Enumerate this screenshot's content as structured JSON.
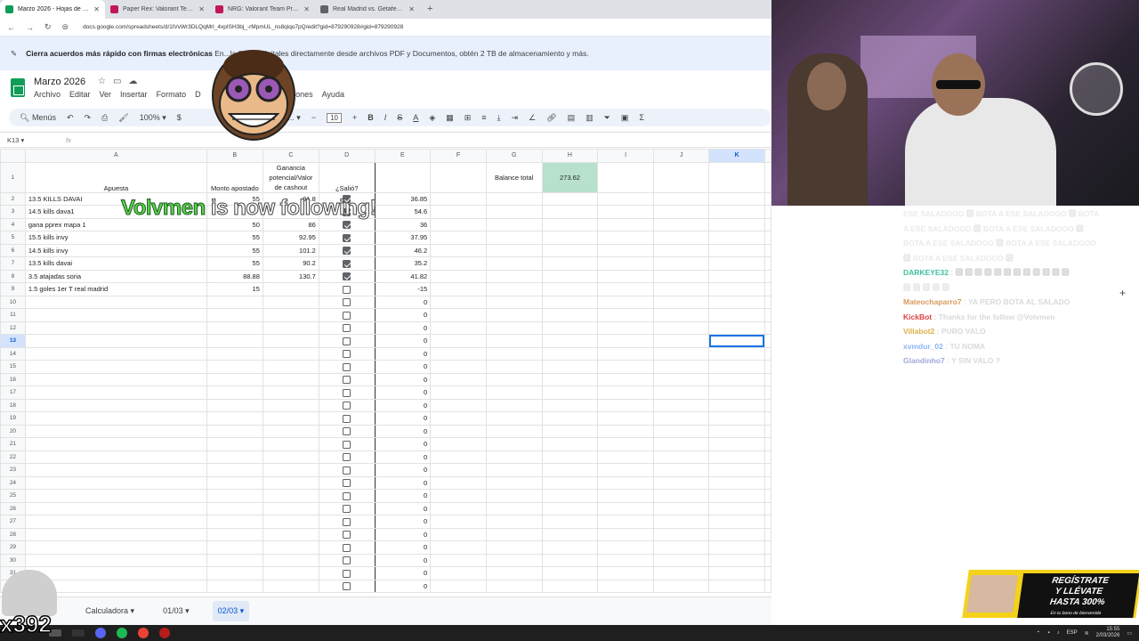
{
  "browser": {
    "tabs": [
      {
        "label": "Marzo 2026 - Hojas de cálculo",
        "color": "#0f9d58",
        "active": true
      },
      {
        "label": "Paper Rex: Valorant Team Profile",
        "color": "#c2185b",
        "active": false
      },
      {
        "label": "NRG: Valorant Team Profile | V...",
        "color": "#c2185b",
        "active": false
      },
      {
        "label": "Real Madrid vs. Getafe CF | Dis...",
        "color": "#5f6368",
        "active": false
      }
    ],
    "url": "docs.google.com/spreadsheets/d/1lVvWr3DLQqMrl_4xpISH3bj_-rMpmUL_ns8qiqo7pQ/edit?gid=879290928#gid=879290928"
  },
  "banner": {
    "bold": "Cierra acuerdos más rápido con firmas electrónicas",
    "text": "En...la firmas digitales directamente desde archivos PDF y Documentos, obtén 2 TB de almacenamiento y más."
  },
  "doc": {
    "title": "Marzo 2026",
    "menu": [
      "Archivo",
      "Editar",
      "Ver",
      "Insertar",
      "Formato",
      "D",
      "siones",
      "Ayuda"
    ]
  },
  "toolbar": {
    "menus_label": "Menús",
    "zoom": "100%",
    "currency": "$",
    "font": "edet...",
    "font_size": "10"
  },
  "formula": {
    "namebox": "K13",
    "fx": "fx"
  },
  "sheet": {
    "columns": [
      "A",
      "B",
      "C",
      "D",
      "E",
      "F",
      "G",
      "H",
      "I",
      "J",
      "K"
    ],
    "header": {
      "a": "Apuesta",
      "b": "Monto apostado",
      "c": "Ganancia potencial/Valor de cashout",
      "d": "¿Salió?",
      "g": "Balance total",
      "h": "273.62"
    },
    "rows": [
      {
        "n": "2",
        "a": "13.5 KILLS DAVAI",
        "b": "55",
        "c": "91.8",
        "checked": true,
        "e": "36.85"
      },
      {
        "n": "3",
        "a": "14.5 kills dava1",
        "b": "",
        "c": "",
        "checked": true,
        "e": "54.6"
      },
      {
        "n": "4",
        "a": "gana pprex mapa 1",
        "b": "50",
        "c": "86",
        "checked": true,
        "e": "36"
      },
      {
        "n": "5",
        "a": "15.5 kills invy",
        "b": "55",
        "c": "92.95",
        "checked": true,
        "e": "37.95"
      },
      {
        "n": "6",
        "a": "14.5 kills invy",
        "b": "55",
        "c": "101.2",
        "checked": true,
        "e": "46.2"
      },
      {
        "n": "7",
        "a": "13.5 kills davai",
        "b": "55",
        "c": "90.2",
        "checked": true,
        "e": "35.2"
      },
      {
        "n": "8",
        "a": "3.5 atajadas soria",
        "b": "88.88",
        "c": "130.7",
        "checked": true,
        "e": "41.82"
      },
      {
        "n": "9",
        "a": "1.5 goles 1er T real madrid",
        "b": "15",
        "c": "",
        "checked": false,
        "e": "-15"
      },
      {
        "n": "10",
        "a": "",
        "b": "",
        "c": "",
        "checked": false,
        "e": "0"
      },
      {
        "n": "11",
        "a": "",
        "b": "",
        "c": "",
        "checked": false,
        "e": "0"
      },
      {
        "n": "12",
        "a": "",
        "b": "",
        "c": "",
        "checked": false,
        "e": "0"
      },
      {
        "n": "13",
        "a": "",
        "b": "",
        "c": "",
        "checked": false,
        "e": "0"
      },
      {
        "n": "14",
        "a": "",
        "b": "",
        "c": "",
        "checked": false,
        "e": "0"
      },
      {
        "n": "15",
        "a": "",
        "b": "",
        "c": "",
        "checked": false,
        "e": "0"
      },
      {
        "n": "16",
        "a": "",
        "b": "",
        "c": "",
        "checked": false,
        "e": "0"
      },
      {
        "n": "17",
        "a": "",
        "b": "",
        "c": "",
        "checked": false,
        "e": "0"
      },
      {
        "n": "18",
        "a": "",
        "b": "",
        "c": "",
        "checked": false,
        "e": "0"
      },
      {
        "n": "19",
        "a": "",
        "b": "",
        "c": "",
        "checked": false,
        "e": "0"
      },
      {
        "n": "20",
        "a": "",
        "b": "",
        "c": "",
        "checked": false,
        "e": "0"
      },
      {
        "n": "21",
        "a": "",
        "b": "",
        "c": "",
        "checked": false,
        "e": "0"
      },
      {
        "n": "22",
        "a": "",
        "b": "",
        "c": "",
        "checked": false,
        "e": "0"
      },
      {
        "n": "23",
        "a": "",
        "b": "",
        "c": "",
        "checked": false,
        "e": "0"
      },
      {
        "n": "24",
        "a": "",
        "b": "",
        "c": "",
        "checked": false,
        "e": "0"
      },
      {
        "n": "25",
        "a": "",
        "b": "",
        "c": "",
        "checked": false,
        "e": "0"
      },
      {
        "n": "26",
        "a": "",
        "b": "",
        "c": "",
        "checked": false,
        "e": "0"
      },
      {
        "n": "27",
        "a": "",
        "b": "",
        "c": "",
        "checked": false,
        "e": "0"
      },
      {
        "n": "28",
        "a": "",
        "b": "",
        "c": "",
        "checked": false,
        "e": "0"
      },
      {
        "n": "29",
        "a": "",
        "b": "",
        "c": "",
        "checked": false,
        "e": "0"
      },
      {
        "n": "30",
        "a": "",
        "b": "",
        "c": "",
        "checked": false,
        "e": "0"
      },
      {
        "n": "31",
        "a": "",
        "b": "",
        "c": "",
        "checked": false,
        "e": "0"
      },
      {
        "n": "32",
        "a": "",
        "b": "",
        "c": "",
        "checked": false,
        "e": "0"
      }
    ]
  },
  "sheet_tabs": [
    "Calculadora",
    "01/03",
    "02/03"
  ],
  "overlay": {
    "follow_name": "Volvmen",
    "follow_text": " is now following!",
    "cat_label": "x392",
    "promo_line1": "REGÍSTRATE",
    "promo_line2": "Y LLÉVATE",
    "promo_line3": "HASTA 300%",
    "promo_sub": "En tu bono de bienvenida"
  },
  "chat": [
    {
      "user": "",
      "text": "ESE SALADOOO 🅾 BOTA A ESE SALADOOO 🅾 BOTA",
      "color": "#d9d9d9"
    },
    {
      "user": "",
      "text": "A ESE SALADOOO 🅾 BOTA A ESE SALADOOO 🅾",
      "color": "#d9d9d9"
    },
    {
      "user": "",
      "text": "BOTA A ESE SALADOOO 🅾 BOTA A ESE SALADOOO",
      "color": "#d9d9d9"
    },
    {
      "user": "",
      "text": "🅾 BOTA A ESE SALADOOO 🅾",
      "color": "#d9d9d9"
    },
    {
      "user": "DARKEYE32",
      "text": " : 🅾 🅾 🅾 🅾 🅾 🅾 🅾 🅾 🅾 🅾 🅾 🅾",
      "color": "#3fbf9f"
    },
    {
      "user": "",
      "text": "🅾 🅾 🅾 🅾 🅾",
      "color": "#d9d9d9"
    },
    {
      "user": "Mateochaparro7",
      "text": " : YA PERO BOTA AL SALADO",
      "color": "#d99a5b"
    },
    {
      "user": "KickBot",
      "text": " : Thanks for the follow @Volvmen",
      "color": "#e04040"
    },
    {
      "user": "Villabot2",
      "text": " : PURO VALO",
      "color": "#d9b04a"
    },
    {
      "user": "xvmdur_02",
      "text": " : TU NOMA",
      "color": "#8ab4f8"
    },
    {
      "user": "Glandinho7",
      "text": " : Y SIN VALO ?",
      "color": "#9fa8da"
    }
  ],
  "taskbar": {
    "lang": "ESP",
    "time": "15:55",
    "date": "2/03/2026"
  }
}
